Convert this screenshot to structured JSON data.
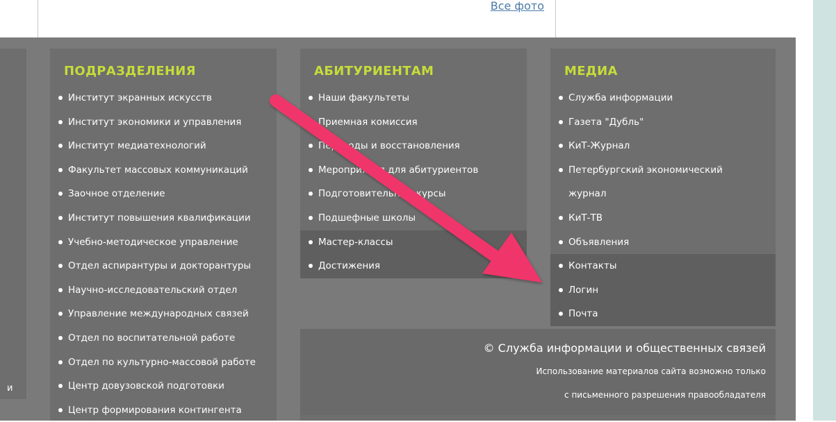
{
  "header": {
    "all_photos": "Все фото"
  },
  "left_column": {
    "partial_text": "и"
  },
  "columns": [
    {
      "title": "ПОДРАЗДЕЛЕНИЯ",
      "items": [
        "Институт экранных искусств",
        "Институт экономики и управления",
        "Институт медиатехнологий",
        "Факультет массовых коммуникаций",
        "Заочное отделение",
        "Институт повышения квалификации",
        "Учебно-методическое управление",
        "Отдел аспирантуры и докторантуры",
        "Научно-исследовательский отдел",
        "Управление международных связей",
        "Отдел по воспитательной работе",
        "Отдел по культурно-массовой работе",
        "Центр довузовской подготовки",
        "Центр формирования контингента"
      ]
    },
    {
      "title": "АБИТУРИЕНТАМ",
      "items": [
        "Наши факультеты",
        "Приемная комиссия",
        "Переводы и восстановления",
        "Мероприятия для абитуриентов",
        "Подготовительные курсы",
        "Подшефные школы",
        "Мастер-классы",
        "Достижения"
      ]
    },
    {
      "title": "МЕДИА",
      "items": [
        "Служба информации",
        "Газета \"Дубль\"",
        "КиТ-Журнал",
        "Петербургский экономический журнал",
        "КиТ-ТВ",
        "Объявления",
        "Контакты",
        "Логин",
        "Почта"
      ]
    }
  ],
  "copyright": {
    "title": "© Служба информации и общественных связей",
    "line1": "Использование материалов сайта возможно только",
    "line2": "с письменного разрешения правообладателя"
  },
  "colors": {
    "accent": "#c6dc3a",
    "arrow": "#f0356a",
    "panel": "#6e6e6e",
    "background": "#7a7a7a"
  }
}
